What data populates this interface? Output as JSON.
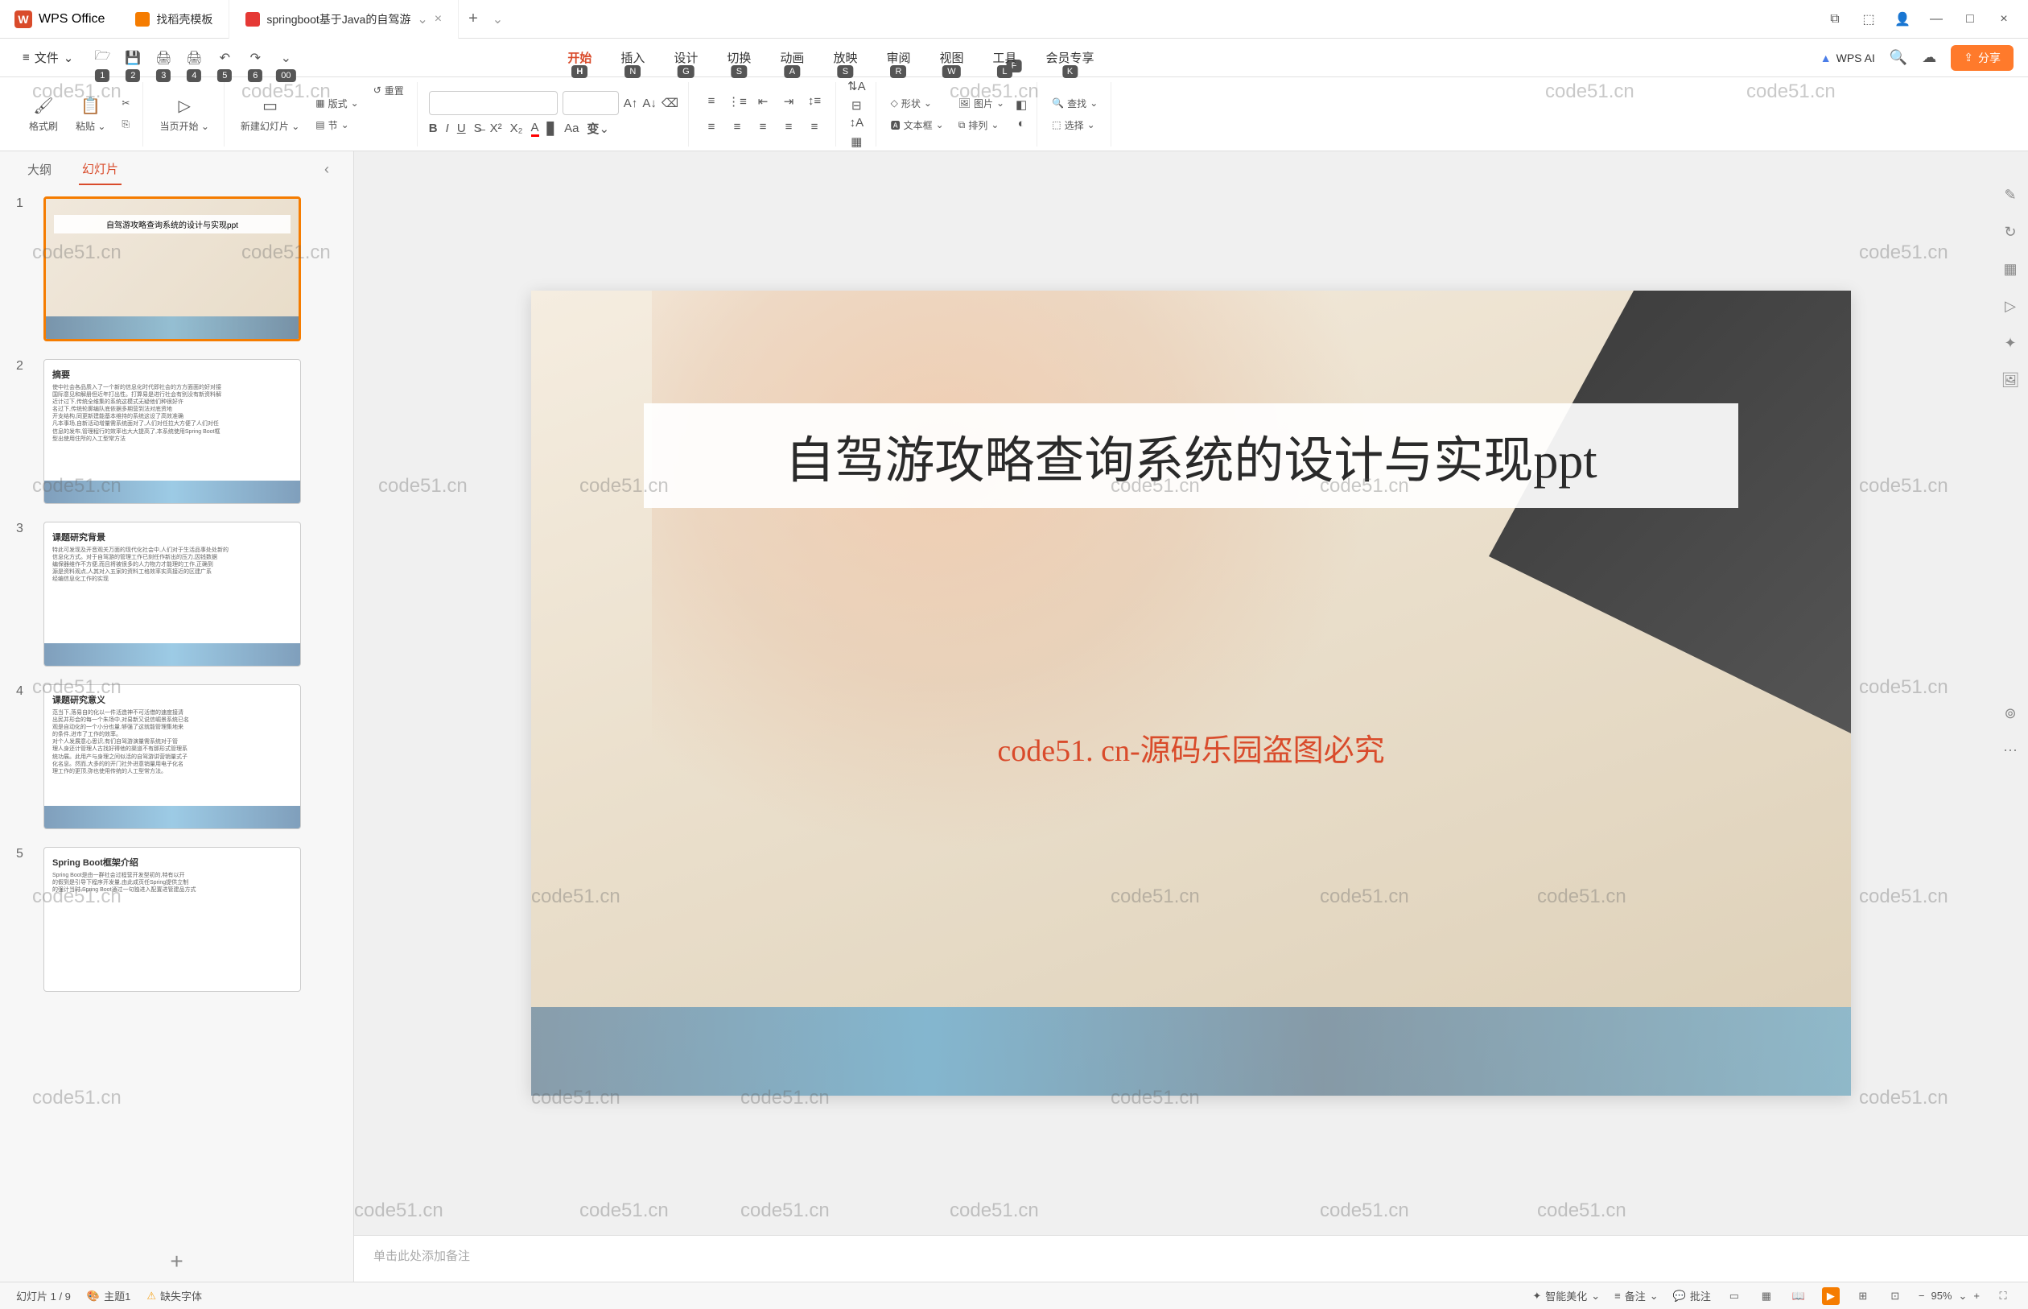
{
  "app": {
    "name": "WPS Office"
  },
  "tabs": [
    {
      "title": "找稻壳模板"
    },
    {
      "title": "springboot基于Java的自驾游"
    }
  ],
  "file_menu": "文件",
  "qat_hints": [
    "F",
    "1",
    "2",
    "3",
    "4",
    "5",
    "6",
    "00"
  ],
  "menu_tabs": {
    "start": "开始",
    "insert": "插入",
    "design": "设计",
    "transition": "切换",
    "animation": "动画",
    "slideshow": "放映",
    "review": "审阅",
    "view": "视图",
    "tools": "工具",
    "member": "会员专享"
  },
  "menu_hints": {
    "start": "H",
    "insert": "N",
    "design": "G",
    "transition": "S",
    "animation": "A",
    "slideshow": "S",
    "review": "R",
    "view": "W",
    "tools": "L",
    "member": "K"
  },
  "wps_ai": "WPS AI",
  "share": "分享",
  "ribbon": {
    "format_painter": "格式刷",
    "paste": "粘贴",
    "current_start": "当页开始",
    "new_slide": "新建幻灯片",
    "layout": "版式",
    "section": "节",
    "reset": "重置",
    "shape": "形状",
    "picture": "图片",
    "textbox": "文本框",
    "arrange": "排列",
    "find": "查找",
    "select": "选择"
  },
  "sidebar": {
    "outline": "大纲",
    "slides": "幻灯片"
  },
  "thumbnails": [
    {
      "num": "1",
      "title": "自驾游攻略查询系统的设计与实现ppt"
    },
    {
      "num": "2",
      "title": "摘要"
    },
    {
      "num": "3",
      "title": "课题研究背景"
    },
    {
      "num": "4",
      "title": "课题研究意义"
    },
    {
      "num": "5",
      "title": "Spring Boot框架介绍"
    }
  ],
  "slide": {
    "title": "自驾游攻略查询系统的设计与实现ppt",
    "watermark": "code51. cn-源码乐园盗图必究"
  },
  "notes_placeholder": "单击此处添加备注",
  "status": {
    "slide_count": "幻灯片 1 / 9",
    "theme": "主题1",
    "missing_font": "缺失字体",
    "beautify": "智能美化",
    "notes": "备注",
    "comments": "批注",
    "zoom": "95%"
  },
  "watermark_text": "code51.cn"
}
